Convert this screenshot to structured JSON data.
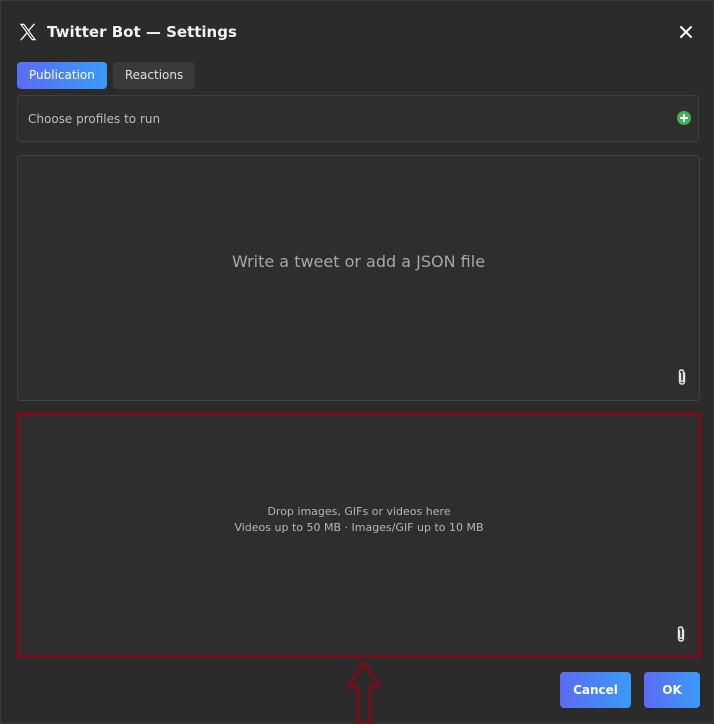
{
  "window": {
    "title": "Twitter Bot — Settings",
    "logo_icon": "x-logo-icon",
    "close_icon": "close-icon"
  },
  "tabs": [
    {
      "label": "Publication",
      "active": true
    },
    {
      "label": "Reactions",
      "active": false
    }
  ],
  "profiles": {
    "label": "Choose profiles to run",
    "add_icon": "plus-circle-icon",
    "add_color": "#3fb34f"
  },
  "tweet": {
    "placeholder": "Write a tweet or add a JSON file",
    "attach_icon": "paperclip-icon"
  },
  "media": {
    "line1": "Drop images, GIFs or videos here",
    "line2": "Videos up to 50 MB · Images/GIF up to 10 MB",
    "attach_icon": "paperclip-icon",
    "highlight_color": "#7a0d18"
  },
  "annotation": {
    "arrow_icon": "up-arrow-icon",
    "color": "#7a0d18"
  },
  "footer": {
    "cancel_label": "Cancel",
    "ok_label": "OK"
  },
  "colors": {
    "accent_start": "#5b6cf5",
    "accent_end": "#3a9af7",
    "background": "#2b2b2b"
  }
}
